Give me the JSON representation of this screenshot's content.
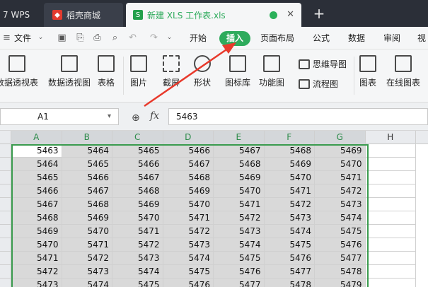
{
  "tabs": {
    "wps_label": "7 WPS",
    "daoke_label": "稻壳商城",
    "doc_label": "新建 XLS 工作表.xls",
    "close_glyph": "✕",
    "add_glyph": "+"
  },
  "menu": {
    "file_label": "文件",
    "items": [
      "开始",
      "插入",
      "页面布局",
      "公式",
      "数据",
      "审阅",
      "视"
    ]
  },
  "ribbon": {
    "pivot_table": "数据透视表",
    "pivot_chart": "数据透视图",
    "table": "表格",
    "picture": "图片",
    "screenshot": "截屏",
    "shape": "形状",
    "icon_lib": "图标库",
    "func_chart": "功能图",
    "mindmap": "思维导图",
    "flowchart": "流程图",
    "chart": "图表",
    "online_chart": "在线图表"
  },
  "formula": {
    "cell_ref": "A1",
    "fx": "fx",
    "value": "5463"
  },
  "grid": {
    "columns": [
      "A",
      "B",
      "C",
      "D",
      "E",
      "F",
      "G",
      "H"
    ],
    "rows": [
      [
        "5463",
        "5464",
        "5465",
        "5466",
        "5467",
        "5468",
        "5469"
      ],
      [
        "5464",
        "5465",
        "5466",
        "5467",
        "5468",
        "5469",
        "5470"
      ],
      [
        "5465",
        "5466",
        "5467",
        "5468",
        "5469",
        "5470",
        "5471"
      ],
      [
        "5466",
        "5467",
        "5468",
        "5469",
        "5470",
        "5471",
        "5472"
      ],
      [
        "5467",
        "5468",
        "5469",
        "5470",
        "5471",
        "5472",
        "5473"
      ],
      [
        "5468",
        "5469",
        "5470",
        "5471",
        "5472",
        "5473",
        "5474"
      ],
      [
        "5469",
        "5470",
        "5471",
        "5472",
        "5473",
        "5474",
        "5475"
      ],
      [
        "5470",
        "5471",
        "5472",
        "5473",
        "5474",
        "5475",
        "5476"
      ],
      [
        "5471",
        "5472",
        "5473",
        "5474",
        "5475",
        "5476",
        "5477"
      ],
      [
        "5472",
        "5473",
        "5474",
        "5475",
        "5476",
        "5477",
        "5478"
      ],
      [
        "5473",
        "5474",
        "5475",
        "5476",
        "5477",
        "5478",
        "5479"
      ]
    ]
  },
  "colors": {
    "accent": "#2eab5c",
    "arrow": "#e8392b",
    "selection": "#3a9b4e"
  }
}
